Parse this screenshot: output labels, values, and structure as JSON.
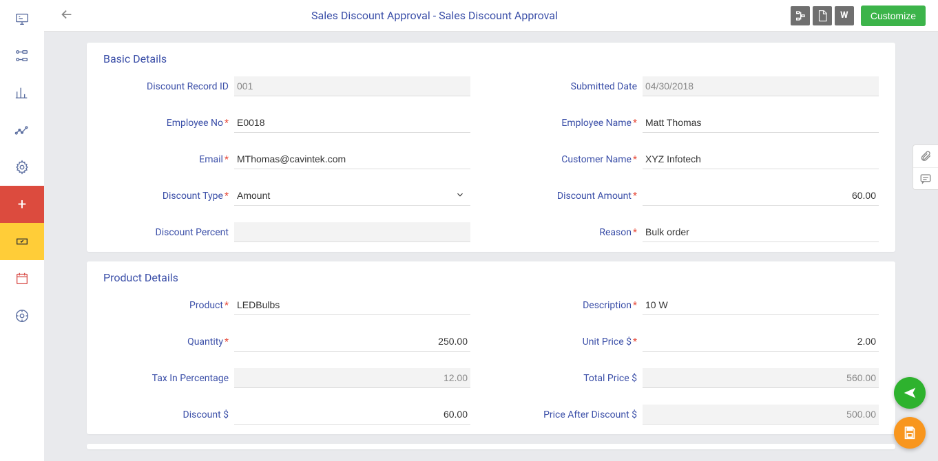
{
  "header": {
    "title": "Sales Discount Approval - Sales Discount Approval",
    "customize": "Customize",
    "icons": {
      "tree": "tree-icon",
      "pdf": "PDF",
      "word": "W"
    }
  },
  "sections": {
    "basic": {
      "title": "Basic Details",
      "fields": {
        "discount_record_id": {
          "label": "Discount Record ID",
          "value": "001"
        },
        "submitted_date": {
          "label": "Submitted Date",
          "value": "04/30/2018"
        },
        "employee_no": {
          "label": "Employee No",
          "value": "E0018"
        },
        "employee_name": {
          "label": "Employee Name",
          "value": "Matt Thomas"
        },
        "email": {
          "label": "Email",
          "value": "MThomas@cavintek.com"
        },
        "customer_name": {
          "label": "Customer Name",
          "value": "XYZ Infotech"
        },
        "discount_type": {
          "label": "Discount Type",
          "value": "Amount"
        },
        "discount_amount": {
          "label": "Discount Amount",
          "value": "60.00"
        },
        "discount_percent": {
          "label": "Discount Percent",
          "value": ""
        },
        "reason": {
          "label": "Reason",
          "value": "Bulk order"
        }
      }
    },
    "product": {
      "title": "Product Details",
      "fields": {
        "product": {
          "label": "Product",
          "value": "LEDBulbs"
        },
        "description": {
          "label": "Description",
          "value": "10 W"
        },
        "quantity": {
          "label": "Quantity",
          "value": "250.00"
        },
        "unit_price": {
          "label": "Unit Price $",
          "value": "2.00"
        },
        "tax_pct": {
          "label": "Tax In Percentage",
          "value": "12.00"
        },
        "total_price": {
          "label": "Total Price $",
          "value": "560.00"
        },
        "discount": {
          "label": "Discount $",
          "value": "60.00"
        },
        "price_after": {
          "label": "Price After Discount $",
          "value": "500.00"
        }
      }
    }
  }
}
